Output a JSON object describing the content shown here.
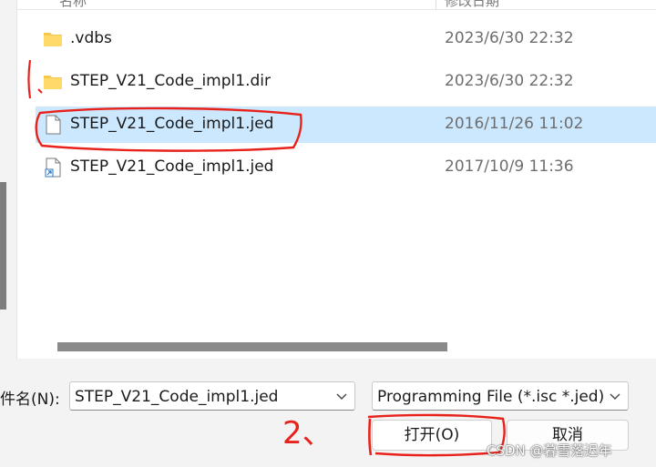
{
  "columns": {
    "name": "名称",
    "date": "修改日期"
  },
  "files": [
    {
      "name": ".vdbs",
      "date": "2023/6/30 22:32",
      "icon": "folder-icon"
    },
    {
      "name": "STEP_V21_Code_impl1.dir",
      "date": "2023/6/30 22:32",
      "icon": "folder-icon"
    },
    {
      "name": "STEP_V21_Code_impl1.jed",
      "date": "2016/11/26 11:02",
      "icon": "file-icon"
    },
    {
      "name": "STEP_V21_Code_impl1.jed",
      "date": "2017/10/9 11:36",
      "icon": "shortcut-file-icon"
    }
  ],
  "filename": {
    "label": "件名(N):",
    "value": "STEP_V21_Code_impl1.jed"
  },
  "filetype": {
    "value": "Programming File (*.isc *.jed)"
  },
  "buttons": {
    "open": "打开(O)",
    "cancel": "取消"
  },
  "annotation": {
    "step_label": "2、"
  },
  "watermark": "CSDN @暮雪落迟年",
  "colors": {
    "selection": "#cce8ff",
    "annotation_red": "#e8221b",
    "folder": "#f7c64a"
  }
}
